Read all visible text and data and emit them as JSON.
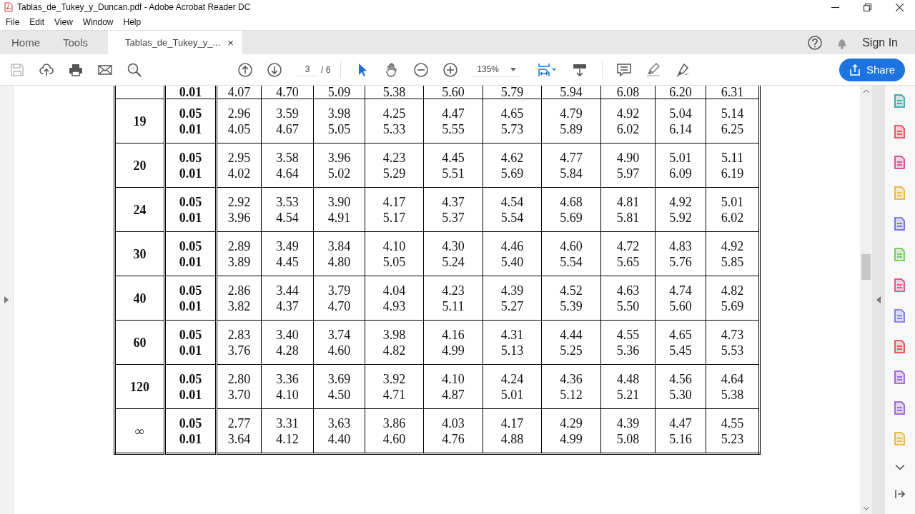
{
  "window": {
    "title": "Tablas_de_Tukey_y_Duncan.pdf - Adobe Acrobat Reader DC"
  },
  "menu": [
    "File",
    "Edit",
    "View",
    "Window",
    "Help"
  ],
  "tabs": [
    {
      "label": "Home",
      "selected": false
    },
    {
      "label": "Tools",
      "selected": false
    },
    {
      "label": "Tablas_de_Tukey_y_...",
      "selected": true,
      "close": "×"
    }
  ],
  "account": {
    "sign_in": "Sign In"
  },
  "toolbar": {
    "page": "3",
    "page_total": "/ 6",
    "zoom": "135%",
    "share": "Share"
  },
  "table": {
    "partial_row": {
      "p": "0.01",
      "values": [
        "4.07",
        "4.70",
        "5.09",
        "5.38",
        "5.60",
        "5.79",
        "5.94",
        "6.08",
        "6.20",
        "6.31"
      ]
    },
    "rows": [
      {
        "df": "19",
        "p": [
          "0.05",
          "0.01"
        ],
        "values": [
          [
            "2.96",
            "3.59",
            "3.98",
            "4.25",
            "4.47",
            "4.65",
            "4.79",
            "4.92",
            "5.04",
            "5.14"
          ],
          [
            "4.05",
            "4.67",
            "5.05",
            "5.33",
            "5.55",
            "5.73",
            "5.89",
            "6.02",
            "6.14",
            "6.25"
          ]
        ]
      },
      {
        "df": "20",
        "p": [
          "0.05",
          "0.01"
        ],
        "values": [
          [
            "2.95",
            "3.58",
            "3.96",
            "4.23",
            "4.45",
            "4.62",
            "4.77",
            "4.90",
            "5.01",
            "5.11"
          ],
          [
            "4.02",
            "4.64",
            "5.02",
            "5.29",
            "5.51",
            "5.69",
            "5.84",
            "5.97",
            "6.09",
            "6.19"
          ]
        ]
      },
      {
        "df": "24",
        "p": [
          "0.05",
          "0.01"
        ],
        "values": [
          [
            "2.92",
            "3.53",
            "3.90",
            "4.17",
            "4.37",
            "4.54",
            "4.68",
            "4.81",
            "4.92",
            "5.01"
          ],
          [
            "3.96",
            "4.54",
            "4.91",
            "5.17",
            "5.37",
            "5.54",
            "5.69",
            "5.81",
            "5.92",
            "6.02"
          ]
        ]
      },
      {
        "df": "30",
        "p": [
          "0.05",
          "0.01"
        ],
        "values": [
          [
            "2.89",
            "3.49",
            "3.84",
            "4.10",
            "4.30",
            "4.46",
            "4.60",
            "4.72",
            "4.83",
            "4.92"
          ],
          [
            "3.89",
            "4.45",
            "4.80",
            "5.05",
            "5.24",
            "5.40",
            "5.54",
            "5.65",
            "5.76",
            "5.85"
          ]
        ]
      },
      {
        "df": "40",
        "p": [
          "0.05",
          "0.01"
        ],
        "values": [
          [
            "2.86",
            "3.44",
            "3.79",
            "4.04",
            "4.23",
            "4.39",
            "4.52",
            "4.63",
            "4.74",
            "4.82"
          ],
          [
            "3.82",
            "4.37",
            "4.70",
            "4.93",
            "5.11",
            "5.27",
            "5.39",
            "5.50",
            "5.60",
            "5.69"
          ]
        ]
      },
      {
        "df": "60",
        "p": [
          "0.05",
          "0.01"
        ],
        "values": [
          [
            "2.83",
            "3.40",
            "3.74",
            "3.98",
            "4.16",
            "4.31",
            "4.44",
            "4.55",
            "4.65",
            "4.73"
          ],
          [
            "3.76",
            "4.28",
            "4.60",
            "4.82",
            "4.99",
            "5.13",
            "5.25",
            "5.36",
            "5.45",
            "5.53"
          ]
        ]
      },
      {
        "df": "120",
        "p": [
          "0.05",
          "0.01"
        ],
        "values": [
          [
            "2.80",
            "3.36",
            "3.69",
            "3.92",
            "4.10",
            "4.24",
            "4.36",
            "4.48",
            "4.56",
            "4.64"
          ],
          [
            "3.70",
            "4.10",
            "4.50",
            "4.71",
            "4.87",
            "5.01",
            "5.12",
            "5.21",
            "5.30",
            "5.38"
          ]
        ]
      },
      {
        "df": "∞",
        "p": [
          "0.05",
          "0.01"
        ],
        "values": [
          [
            "2.77",
            "3.31",
            "3.63",
            "3.86",
            "4.03",
            "4.17",
            "4.29",
            "4.39",
            "4.47",
            "4.55"
          ],
          [
            "3.64",
            "4.12",
            "4.40",
            "4.60",
            "4.76",
            "4.88",
            "4.99",
            "5.08",
            "5.16",
            "5.23"
          ]
        ]
      }
    ]
  }
}
